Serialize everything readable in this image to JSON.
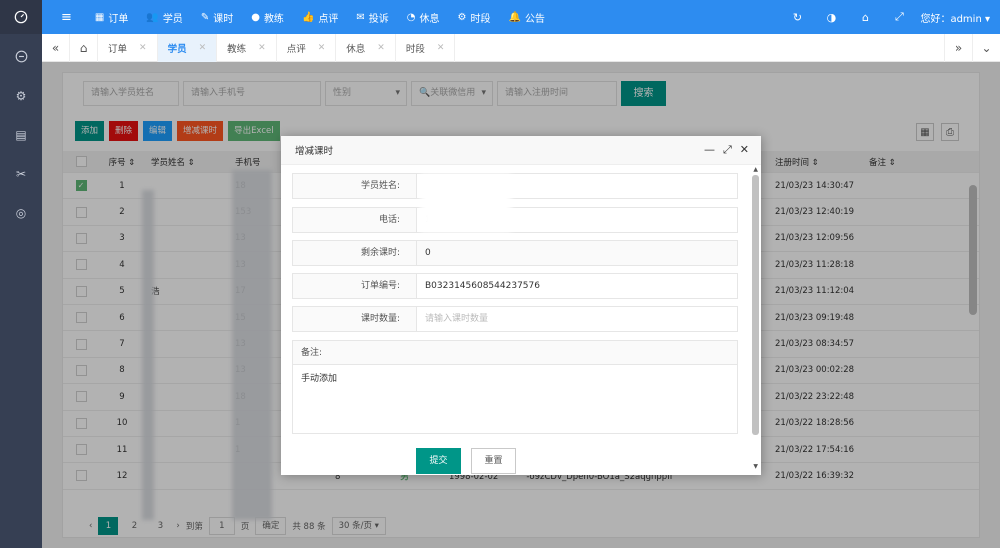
{
  "header": {
    "nav": [
      {
        "icon": "list-icon",
        "label": "订单"
      },
      {
        "icon": "users-icon",
        "label": "学员"
      },
      {
        "icon": "edit-icon",
        "label": "课时"
      },
      {
        "icon": "user-icon",
        "label": "教练"
      },
      {
        "icon": "thumbs-up-icon",
        "label": "点评"
      },
      {
        "icon": "complaint-icon",
        "label": "投诉"
      },
      {
        "icon": "rest-icon",
        "label": "休息"
      },
      {
        "icon": "gear-icon",
        "label": "时段"
      },
      {
        "icon": "bell-icon",
        "label": "公告"
      }
    ],
    "greeting": "您好：admin",
    "colors": {
      "primary": "#2d8cf0",
      "sidebar": "#363f53",
      "teal": "#009688"
    }
  },
  "tabs": [
    "订单",
    "学员",
    "教练",
    "点评",
    "休息",
    "时段"
  ],
  "active_tab": "学员",
  "search": {
    "name_placeholder": "请输入学员姓名",
    "phone_placeholder": "请输入手机号",
    "gender_placeholder": "性别",
    "wechat_placeholder": "关联微信用",
    "reg_placeholder": "请输入注册时间",
    "search_label": "搜索"
  },
  "actions": {
    "add": "添加",
    "delete": "删除",
    "edit": "编辑",
    "adjust": "增减课时",
    "export": "导出Excel"
  },
  "table": {
    "headers": {
      "no": "序号",
      "name": "学员姓名",
      "phone": "手机号",
      "reg": "注册时间",
      "note": "备注"
    },
    "rows": [
      {
        "no": "1",
        "name": "",
        "phone": "18",
        "time": "21/03/23 14:30:47",
        "checked": true
      },
      {
        "no": "2",
        "name": "",
        "phone": "153",
        "time": "21/03/23 12:40:19"
      },
      {
        "no": "3",
        "name": "",
        "phone": "13",
        "time": "21/03/23 12:09:56"
      },
      {
        "no": "4",
        "name": "",
        "phone": "13",
        "time": "21/03/23 11:28:18"
      },
      {
        "no": "5",
        "name": "浩",
        "phone": "17",
        "time": "21/03/23 11:12:04"
      },
      {
        "no": "6",
        "name": "",
        "phone": "15",
        "time": "21/03/23 09:19:48"
      },
      {
        "no": "7",
        "name": "",
        "phone": "13",
        "time": "21/03/23 08:34:57"
      },
      {
        "no": "8",
        "name": "",
        "phone": "13",
        "time": "21/03/23 00:02:28"
      },
      {
        "no": "9",
        "name": "",
        "phone": "18",
        "time": "21/03/22 23:22:48"
      },
      {
        "no": "10",
        "name": "",
        "phone": "1",
        "time": "21/03/22 18:28:56"
      },
      {
        "no": "11",
        "name": "",
        "phone": "1",
        "time": "21/03/22 17:54:16"
      },
      {
        "no": "12",
        "name": "",
        "phone": "",
        "time": "21/03/22 16:39:32"
      }
    ],
    "row12_extra": {
      "count": "8",
      "gender": "男",
      "birth": "1998-02-02",
      "openid": "-o9zCDv_Dpen0-BO1a_S2aqgnppII"
    }
  },
  "pager": {
    "pages": [
      "1",
      "2",
      "3"
    ],
    "goto_label": "到第",
    "page_input": "1",
    "page_unit": "页",
    "confirm": "确定",
    "total": "共 88 条",
    "size": "30 条/页"
  },
  "modal": {
    "title": "增减课时",
    "fields": [
      {
        "label": "学员姓名:",
        "value": ""
      },
      {
        "label": "电话:",
        "value": "18"
      },
      {
        "label": "剩余课时:",
        "value": "0"
      },
      {
        "label": "订单编号:",
        "value": "B0323145608544237576"
      },
      {
        "label": "课时数量:",
        "placeholder": "请输入课时数量"
      }
    ],
    "notes_label": "备注:",
    "notes_value": "手动添加",
    "submit": "提交",
    "reset": "重置"
  }
}
